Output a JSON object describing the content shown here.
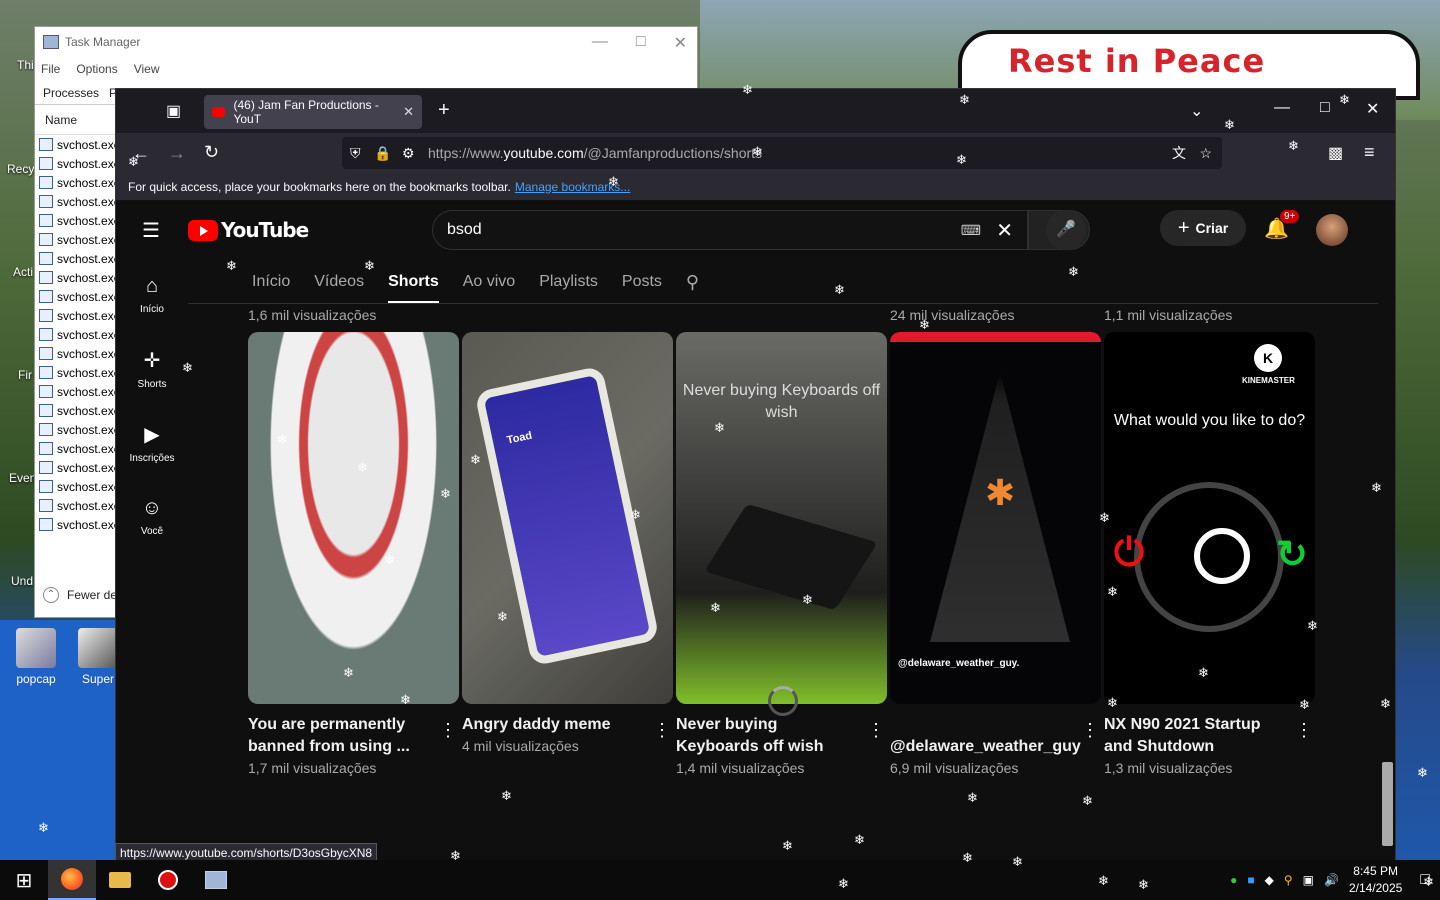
{
  "desktop": {
    "sign_text": "Rest in Peace",
    "icons": [
      {
        "label": "popcap"
      },
      {
        "label": "Super"
      }
    ],
    "side_labels": [
      "Thi",
      "Recy",
      "Acti",
      "Fir",
      "Even",
      "Und"
    ]
  },
  "task_manager": {
    "title": "Task Manager",
    "menu": [
      "File",
      "Options",
      "View"
    ],
    "tabs": [
      "Processes",
      "Pe"
    ],
    "column": "Name",
    "rows": [
      "svchost.exe",
      "svchost.exe",
      "svchost.exe",
      "svchost.exe",
      "svchost.exe",
      "svchost.exe",
      "svchost.exe",
      "svchost.exe",
      "svchost.exe",
      "svchost.exe",
      "svchost.exe",
      "svchost.exe",
      "svchost.exe",
      "svchost.exe",
      "svchost.exe",
      "svchost.exe",
      "svchost.exe",
      "svchost.exe",
      "svchost.exe",
      "svchost.exe",
      "svchost.exe"
    ],
    "fewer": "Fewer de"
  },
  "browser": {
    "tab_title": "(46) Jam Fan Productions - YouT",
    "url_prefix": "https://www.",
    "url_domain": "youtube.com",
    "url_path": "/@Jamfanproductions/shorts",
    "bookmarks_text": "For quick access, place your bookmarks here on the bookmarks toolbar.",
    "bookmarks_link": "Manage bookmarks...",
    "status_url": "https://www.youtube.com/shorts/D3osGbycXN8"
  },
  "youtube": {
    "logo": "YouTube",
    "search_value": "bsod",
    "create_label": "Criar",
    "notif_badge": "9+",
    "sidebar": [
      {
        "label": "Início",
        "icon": "home-icon"
      },
      {
        "label": "Shorts",
        "icon": "shorts-icon"
      },
      {
        "label": "Inscrições",
        "icon": "subscriptions-icon"
      },
      {
        "label": "Você",
        "icon": "you-icon"
      }
    ],
    "tabs": [
      "Início",
      "Vídeos",
      "Shorts",
      "Ao vivo",
      "Playlists",
      "Posts"
    ],
    "active_tab": "Shorts",
    "prev_row_views": [
      "1,6 mil visualizações",
      "24 mil visualizações",
      "1,1 mil visualizações"
    ],
    "shorts": [
      {
        "title": "You are permanently banned from using ...",
        "views": "1,7 mil visualizações"
      },
      {
        "title": "Angry daddy meme",
        "views": "4 mil visualizações"
      },
      {
        "title": "Never buying Keyboards off wish",
        "views": "1,4 mil visualizações",
        "caption": "Never buying Keyboards off wish"
      },
      {
        "title": "@delaware_weather_guy",
        "views": "6,9 mil visualizações",
        "handle": "@delaware_weather_guy."
      },
      {
        "title": "NX N90 2021 Startup and Shutdown",
        "views": "1,3 mil visualizações",
        "question": "What would you like to do?",
        "brand": "KINEMASTER"
      }
    ],
    "phone_name": "Toad"
  },
  "taskbar": {
    "time": "8:45 PM",
    "date": "2/14/2025"
  }
}
